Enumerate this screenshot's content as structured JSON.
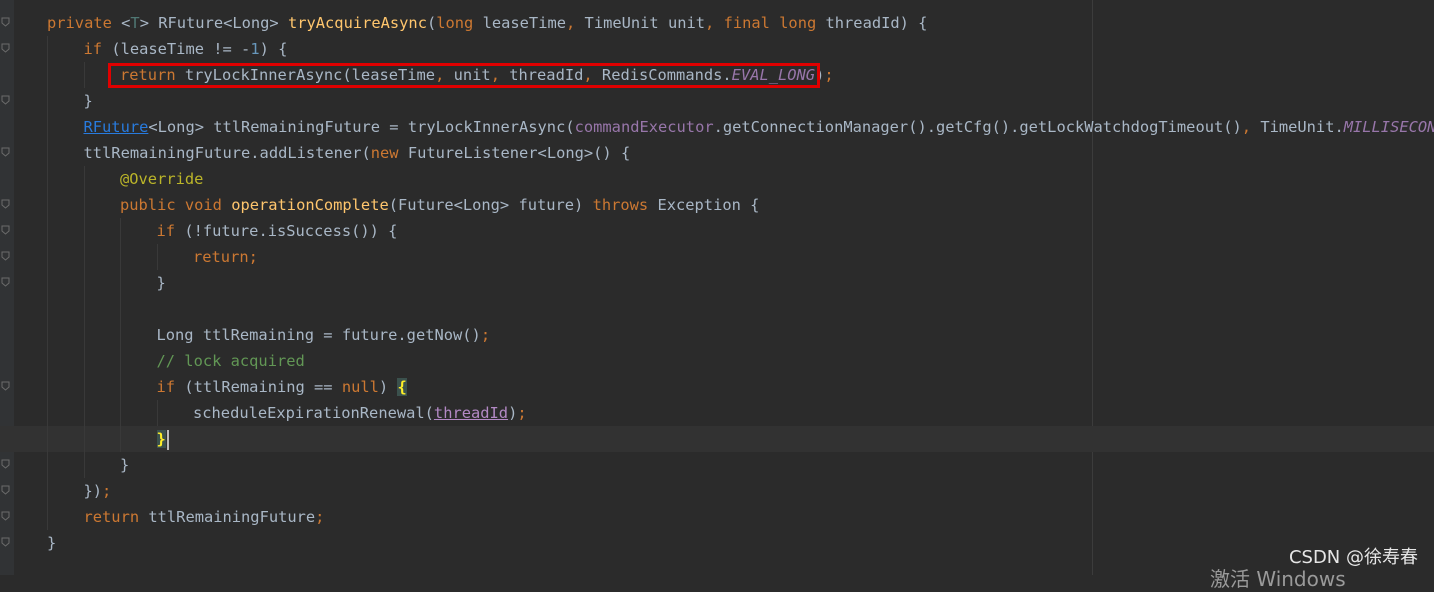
{
  "editor": {
    "lines": [
      {
        "indent": 0,
        "current": false,
        "tokens": [
          {
            "t": "private ",
            "c": "kw"
          },
          {
            "t": "<",
            "c": ""
          },
          {
            "t": "T",
            "c": "gen"
          },
          {
            "t": "> RFuture<Long> ",
            "c": ""
          },
          {
            "t": "tryAcquireAsync",
            "c": "fn"
          },
          {
            "t": "(",
            "c": ""
          },
          {
            "t": "long ",
            "c": "kw"
          },
          {
            "t": "leaseTime",
            "c": ""
          },
          {
            "t": ", ",
            "c": "kw"
          },
          {
            "t": "TimeUnit unit",
            "c": ""
          },
          {
            "t": ", ",
            "c": "kw"
          },
          {
            "t": "final long ",
            "c": "kw"
          },
          {
            "t": "threadId) {",
            "c": ""
          }
        ]
      },
      {
        "indent": 1,
        "current": false,
        "tokens": [
          {
            "t": "if ",
            "c": "kw"
          },
          {
            "t": "(leaseTime != -",
            "c": ""
          },
          {
            "t": "1",
            "c": "num"
          },
          {
            "t": ") {",
            "c": ""
          }
        ]
      },
      {
        "indent": 2,
        "current": false,
        "tokens": [
          {
            "t": "return ",
            "c": "kw"
          },
          {
            "t": "tryLockInnerAsync(leaseTime",
            "c": ""
          },
          {
            "t": ", ",
            "c": "kw"
          },
          {
            "t": "unit",
            "c": ""
          },
          {
            "t": ", ",
            "c": "kw"
          },
          {
            "t": "threadId",
            "c": ""
          },
          {
            "t": ", ",
            "c": "kw"
          },
          {
            "t": "RedisCommands.",
            "c": ""
          },
          {
            "t": "EVAL_LONG",
            "c": "field-it"
          },
          {
            "t": ")",
            "c": ""
          },
          {
            "t": ";",
            "c": "kw"
          }
        ]
      },
      {
        "indent": 1,
        "current": false,
        "tokens": [
          {
            "t": "}",
            "c": ""
          }
        ]
      },
      {
        "indent": 1,
        "current": false,
        "tokens": [
          {
            "t": "RFuture",
            "c": "typeref"
          },
          {
            "t": "<Long> ttlRemainingFuture = tryLockInnerAsync(",
            "c": ""
          },
          {
            "t": "commandExecutor",
            "c": "field"
          },
          {
            "t": ".getConnectionManager().getCfg().getLockWatchdogTimeout()",
            "c": ""
          },
          {
            "t": ", ",
            "c": "kw"
          },
          {
            "t": "TimeUnit.",
            "c": ""
          },
          {
            "t": "MILLISECONDS",
            "c": "field-it"
          },
          {
            "t": ",",
            "c": "kw"
          }
        ]
      },
      {
        "indent": 1,
        "current": false,
        "tokens": [
          {
            "t": "ttlRemainingFuture.addListener(",
            "c": ""
          },
          {
            "t": "new ",
            "c": "kw"
          },
          {
            "t": "FutureListener<Long>() {",
            "c": ""
          }
        ]
      },
      {
        "indent": 2,
        "current": false,
        "tokens": [
          {
            "t": "@Override",
            "c": "ann"
          }
        ]
      },
      {
        "indent": 2,
        "current": false,
        "tokens": [
          {
            "t": "public void ",
            "c": "kw"
          },
          {
            "t": "operationComplete",
            "c": "fn"
          },
          {
            "t": "(Future<Long> future) ",
            "c": ""
          },
          {
            "t": "throws ",
            "c": "kw"
          },
          {
            "t": "Exception {",
            "c": ""
          }
        ]
      },
      {
        "indent": 3,
        "current": false,
        "tokens": [
          {
            "t": "if ",
            "c": "kw"
          },
          {
            "t": "(!future.isSuccess()) {",
            "c": ""
          }
        ]
      },
      {
        "indent": 4,
        "current": false,
        "tokens": [
          {
            "t": "return;",
            "c": "kw"
          }
        ]
      },
      {
        "indent": 3,
        "current": false,
        "tokens": [
          {
            "t": "}",
            "c": ""
          }
        ]
      },
      {
        "indent": 3,
        "current": false,
        "tokens": []
      },
      {
        "indent": 3,
        "current": false,
        "tokens": [
          {
            "t": "Long ttlRemaining = future.getNow()",
            "c": ""
          },
          {
            "t": ";",
            "c": "kw"
          }
        ]
      },
      {
        "indent": 3,
        "current": false,
        "tokens": [
          {
            "t": "// lock acquired",
            "c": "cmt"
          }
        ]
      },
      {
        "indent": 3,
        "current": false,
        "tokens": [
          {
            "t": "if ",
            "c": "kw"
          },
          {
            "t": "(ttlRemaining == ",
            "c": ""
          },
          {
            "t": "null",
            "c": "kw"
          },
          {
            "t": ") ",
            "c": ""
          },
          {
            "t": "{",
            "c": "brace-match"
          }
        ]
      },
      {
        "indent": 4,
        "current": false,
        "tokens": [
          {
            "t": "scheduleExpirationRenewal(",
            "c": ""
          },
          {
            "t": "threadId",
            "c": "param-u"
          },
          {
            "t": ")",
            "c": ""
          },
          {
            "t": ";",
            "c": "kw"
          }
        ]
      },
      {
        "indent": 3,
        "current": true,
        "tokens": [
          {
            "t": "}",
            "c": "brace-match"
          },
          {
            "t": "",
            "c": "caret"
          }
        ]
      },
      {
        "indent": 2,
        "current": false,
        "tokens": [
          {
            "t": "}",
            "c": ""
          }
        ]
      },
      {
        "indent": 1,
        "current": false,
        "tokens": [
          {
            "t": "})",
            "c": ""
          },
          {
            "t": ";",
            "c": "kw"
          }
        ]
      },
      {
        "indent": 1,
        "current": false,
        "tokens": [
          {
            "t": "return ",
            "c": "kw"
          },
          {
            "t": "ttlRemainingFuture",
            "c": ""
          },
          {
            "t": ";",
            "c": "kw"
          }
        ]
      },
      {
        "indent": 0,
        "current": false,
        "tokens": [
          {
            "t": "}",
            "c": ""
          }
        ]
      }
    ]
  },
  "overlay": {
    "watermark": "CSDN @徐寿春",
    "activate_text": "激活 Windows"
  },
  "colors": {
    "background": "#2b2b2b",
    "keyword": "#cc7832",
    "method": "#ffc66d",
    "field": "#9876aa",
    "number": "#6897bb",
    "annotation": "#bbb529",
    "comment": "#629755",
    "highlight_box": "#e00000"
  }
}
